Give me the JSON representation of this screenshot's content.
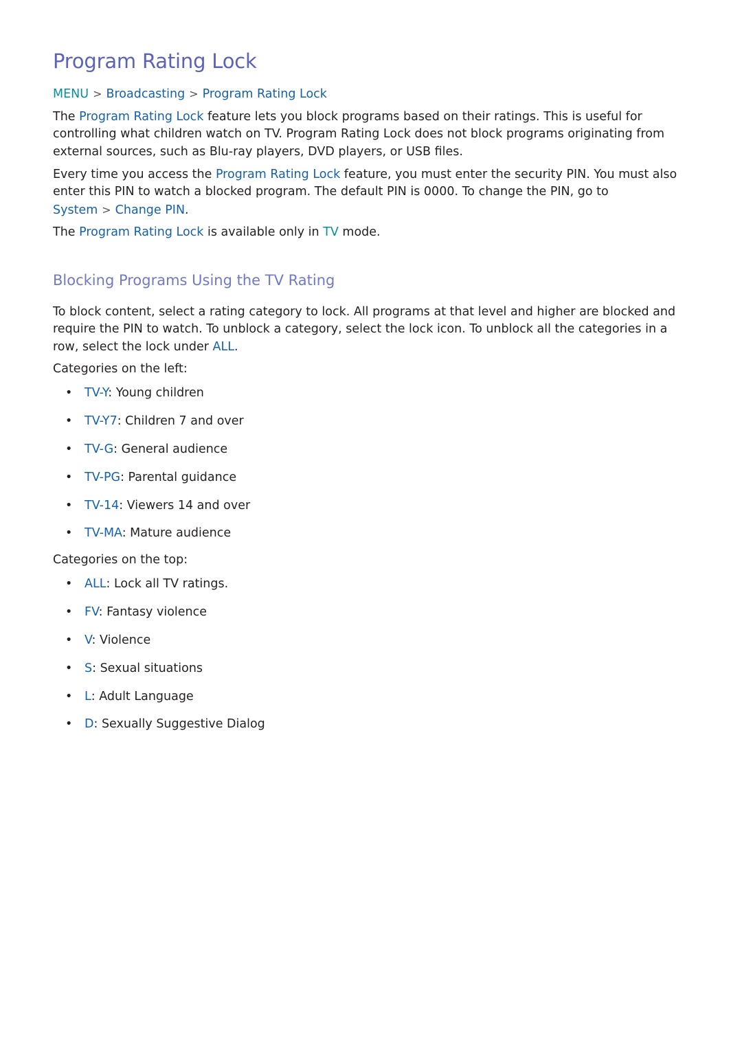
{
  "title": "Program Rating Lock",
  "breadcrumb": {
    "items": [
      "MENU",
      "Broadcasting",
      "Program Rating Lock"
    ],
    "separator": ">"
  },
  "intro": {
    "p1": {
      "pre": "The ",
      "link": "Program Rating Lock",
      "post": " feature lets you block programs based on their ratings. This is useful for controlling what children watch on TV. Program Rating Lock does not block programs originating from external sources, such as Blu-ray players, DVD players, or USB files."
    },
    "p2": {
      "pre": "Every time you access the ",
      "link": "Program Rating Lock",
      "post": " feature, you must enter the security PIN. You must also enter this PIN to watch a blocked program. The default PIN is 0000. To change the PIN, go to ",
      "link2": "System",
      "sep": ">",
      "link3": "Change PIN",
      "end": "."
    },
    "p3": {
      "pre": "The ",
      "link": "Program Rating Lock",
      "mid": " is available only in ",
      "link2": "TV",
      "post": " mode."
    }
  },
  "section": {
    "heading": "Blocking Programs Using the TV Rating",
    "p1": {
      "pre": "To block content, select a rating category to lock. All programs at that level and higher are blocked and require the PIN to watch. To unblock a category, select the lock icon. To unblock all the categories in a row, select the lock under ",
      "link": "ALL",
      "post": "."
    },
    "left_label": "Categories on the left:",
    "left_items": [
      {
        "code": "TV-Y",
        "desc": ": Young children"
      },
      {
        "code": "TV-Y7",
        "desc": ": Children 7 and over"
      },
      {
        "code": "TV-G",
        "desc": ": General audience"
      },
      {
        "code": "TV-PG",
        "desc": ": Parental guidance"
      },
      {
        "code": "TV-14",
        "desc": ": Viewers 14 and over"
      },
      {
        "code": "TV-MA",
        "desc": ": Mature audience"
      }
    ],
    "top_label": "Categories on the top:",
    "top_items": [
      {
        "code": "ALL",
        "desc": ": Lock all TV ratings."
      },
      {
        "code": "FV",
        "desc": ": Fantasy violence"
      },
      {
        "code": "V",
        "desc": ": Violence"
      },
      {
        "code": "S",
        "desc": ": Sexual situations"
      },
      {
        "code": "L",
        "desc": ": Adult Language"
      },
      {
        "code": "D",
        "desc": ": Sexually Suggestive Dialog"
      }
    ],
    "bullet": "•"
  },
  "colors": {
    "title": "#5b63b9",
    "subheading": "#7179c2",
    "link_blue": "#1560a8",
    "link_teal": "#078d9c",
    "text": "#231f20"
  }
}
